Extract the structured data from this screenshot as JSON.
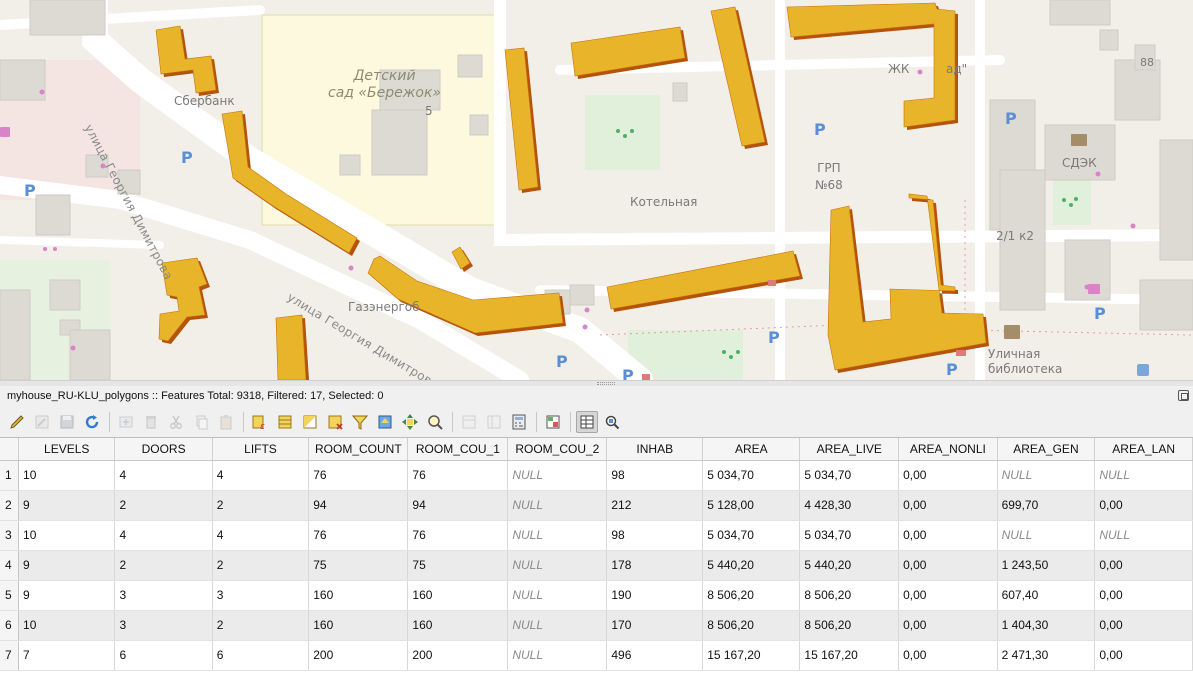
{
  "map": {
    "labels": {
      "kindergarten_line1": "Детский",
      "kindergarten_line2": "сад «Бережок»",
      "kindergarten_number": "5",
      "sberbank": "Сбербанк",
      "street_top": "улица Георгия Димитрова",
      "street_bottom": "улица Георгия Димитрова",
      "boiler": "Котельная",
      "grp_line1": "ГРП",
      "grp_line2": "№68",
      "gazenergo": "Газэнергоб",
      "jk": "ЖК",
      "jk_suffix": "ад\"",
      "sdek": "СДЭК",
      "house_21k2": "2/1 к2",
      "house_88": "88",
      "library_line1": "Уличная",
      "library_line2": "библиотека",
      "parking": "P"
    }
  },
  "panel": {
    "title": "myhouse_RU-KLU_polygons :: Features Total: 9318, Filtered: 17, Selected: 0"
  },
  "toolbar": {
    "buttons": [
      {
        "icon": "pencil-icon",
        "enabled": true
      },
      {
        "icon": "multi-edit-icon",
        "enabled": false
      },
      {
        "icon": "save-edits-icon",
        "enabled": false
      },
      {
        "icon": "reload-icon",
        "enabled": true
      },
      {
        "sep": true
      },
      {
        "icon": "add-feature-icon",
        "enabled": false
      },
      {
        "icon": "delete-icon",
        "enabled": false
      },
      {
        "icon": "cut-icon",
        "enabled": false
      },
      {
        "icon": "copy-icon",
        "enabled": false
      },
      {
        "icon": "paste-icon",
        "enabled": false
      },
      {
        "sep": true
      },
      {
        "icon": "select-expression-icon",
        "enabled": true
      },
      {
        "icon": "select-all-icon",
        "enabled": true
      },
      {
        "icon": "invert-selection-icon",
        "enabled": true
      },
      {
        "icon": "deselect-icon",
        "enabled": true
      },
      {
        "icon": "filter-icon",
        "enabled": true
      },
      {
        "icon": "move-top-icon",
        "enabled": true
      },
      {
        "icon": "pan-to-icon",
        "enabled": true
      },
      {
        "icon": "zoom-to-icon",
        "enabled": true
      },
      {
        "sep": true
      },
      {
        "icon": "new-field-icon",
        "enabled": false
      },
      {
        "icon": "delete-field-icon",
        "enabled": false
      },
      {
        "icon": "field-calculator-icon",
        "enabled": true
      },
      {
        "sep": true
      },
      {
        "icon": "conditional-format-icon",
        "enabled": true
      },
      {
        "sep": true
      },
      {
        "icon": "table-view-icon",
        "enabled": true,
        "active": true
      },
      {
        "icon": "form-view-icon",
        "enabled": true
      }
    ]
  },
  "table": {
    "columns": [
      "LEVELS",
      "DOORS",
      "LIFTS",
      "ROOM_COUNT",
      "ROOM_COU_1",
      "ROOM_COU_2",
      "INHAB",
      "AREA",
      "AREA_LIVE",
      "AREA_NONLI",
      "AREA_GEN",
      "AREA_LAN"
    ],
    "rows": [
      {
        "num": "1",
        "cells": [
          "10",
          "4",
          "4",
          "76",
          "76",
          "NULL",
          "98",
          "5 034,70",
          "5 034,70",
          "0,00",
          "NULL",
          "NULL"
        ]
      },
      {
        "num": "2",
        "cells": [
          "9",
          "2",
          "2",
          "94",
          "94",
          "NULL",
          "212",
          "5 128,00",
          "4 428,30",
          "0,00",
          "699,70",
          "0,00"
        ]
      },
      {
        "num": "3",
        "cells": [
          "10",
          "4",
          "4",
          "76",
          "76",
          "NULL",
          "98",
          "5 034,70",
          "5 034,70",
          "0,00",
          "NULL",
          "NULL"
        ]
      },
      {
        "num": "4",
        "cells": [
          "9",
          "2",
          "2",
          "75",
          "75",
          "NULL",
          "178",
          "5 440,20",
          "5 440,20",
          "0,00",
          "1 243,50",
          "0,00"
        ]
      },
      {
        "num": "5",
        "cells": [
          "9",
          "3",
          "3",
          "160",
          "160",
          "NULL",
          "190",
          "8 506,20",
          "8 506,20",
          "0,00",
          "607,40",
          "0,00"
        ]
      },
      {
        "num": "6",
        "cells": [
          "10",
          "3",
          "2",
          "160",
          "160",
          "NULL",
          "170",
          "8 506,20",
          "8 506,20",
          "0,00",
          "1 404,30",
          "0,00"
        ]
      },
      {
        "num": "7",
        "cells": [
          "7",
          "6",
          "6",
          "200",
          "200",
          "NULL",
          "496",
          "15 167,20",
          "15 167,20",
          "0,00",
          "2 471,30",
          "0,00"
        ]
      }
    ]
  },
  "colors": {
    "building_fill": "#e8b42a",
    "building_shadow": "#b5530a",
    "map_bg": "#f2efe9",
    "kindergarten_bg": "#fdf9df",
    "park_green": "#e1f0da",
    "road": "#ffffff"
  }
}
